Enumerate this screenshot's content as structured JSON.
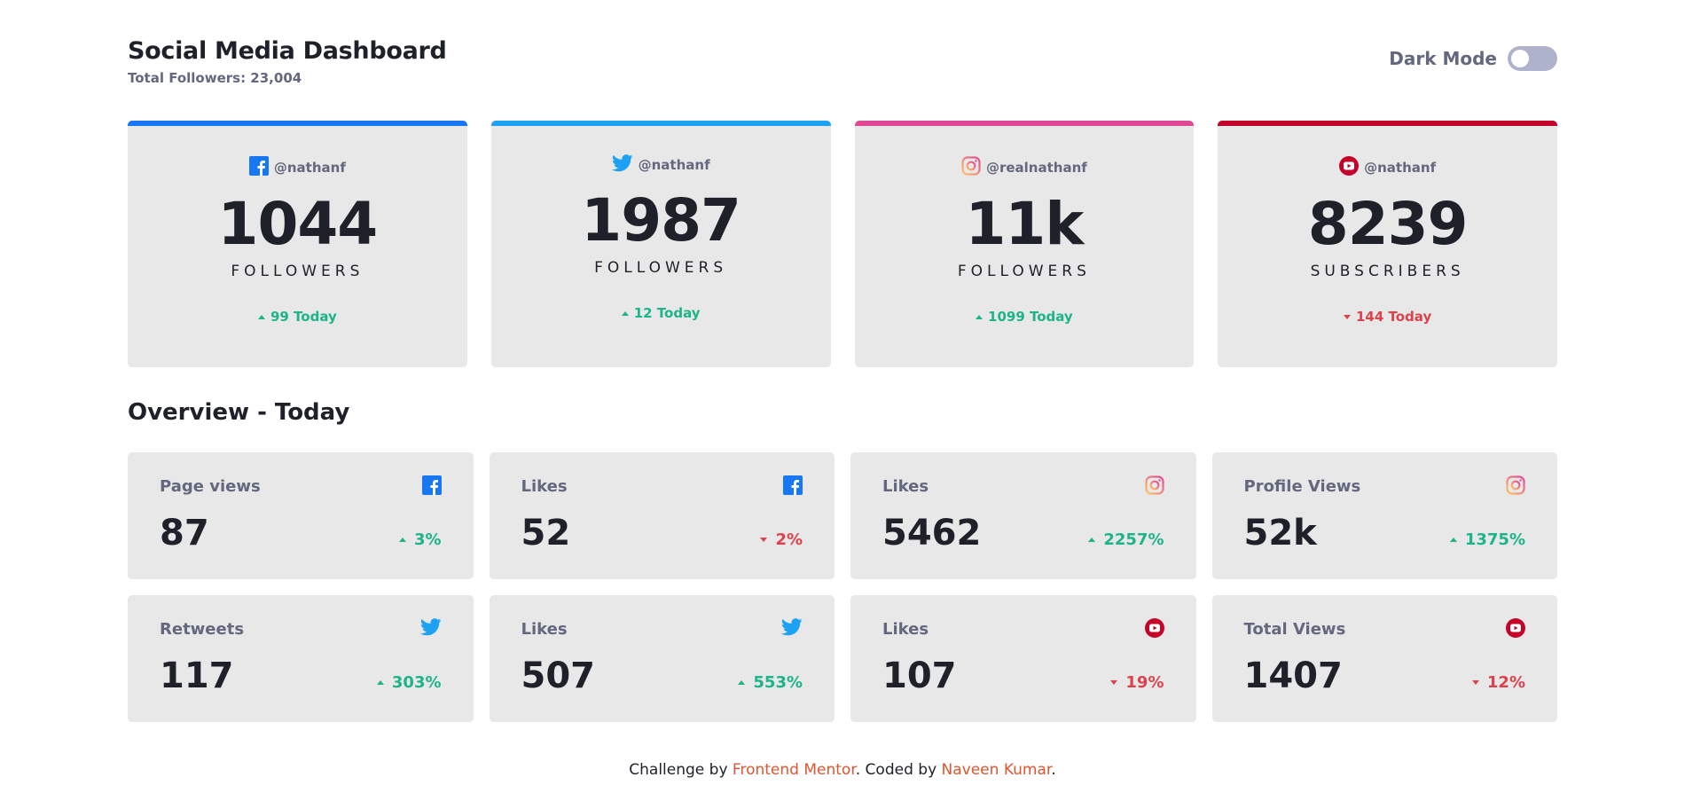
{
  "header": {
    "title": "Social Media Dashboard",
    "subtitle": "Total Followers: 23,004",
    "dark_mode_label": "Dark Mode"
  },
  "colors": {
    "facebook": "#1877f2",
    "twitter": "#1da1f2",
    "instagram_gradient": [
      "#fdc468",
      "#df4996"
    ],
    "youtube": "#c4032a",
    "up": "#1db489",
    "down": "#dc414c",
    "card_bg": "#e8e8e8",
    "footer_link": "#e0552f"
  },
  "cards": [
    {
      "network": "facebook",
      "icon": "facebook-icon",
      "handle": "@nathanf",
      "count": "1044",
      "unit": "FOLLOWERS",
      "today": "99 Today",
      "trend": "up"
    },
    {
      "network": "twitter",
      "icon": "twitter-icon",
      "handle": "@nathanf",
      "count": "1987",
      "unit": "FOLLOWERS",
      "today": "12 Today",
      "trend": "up"
    },
    {
      "network": "instagram",
      "icon": "instagram-icon",
      "handle": "@realnathanf",
      "count": "11k",
      "unit": "FOLLOWERS",
      "today": "1099 Today",
      "trend": "up"
    },
    {
      "network": "youtube",
      "icon": "youtube-icon",
      "handle": "@nathanf",
      "count": "8239",
      "unit": "SUBSCRIBERS",
      "today": "144 Today",
      "trend": "down"
    }
  ],
  "overview": {
    "title": "Overview - Today",
    "tiles": [
      {
        "label": "Page views",
        "icon": "facebook-icon",
        "value": "87",
        "pct": "3%",
        "trend": "up"
      },
      {
        "label": "Likes",
        "icon": "facebook-icon",
        "value": "52",
        "pct": "2%",
        "trend": "down"
      },
      {
        "label": "Likes",
        "icon": "instagram-icon",
        "value": "5462",
        "pct": "2257%",
        "trend": "up"
      },
      {
        "label": "Profile Views",
        "icon": "instagram-icon",
        "value": "52k",
        "pct": "1375%",
        "trend": "up"
      },
      {
        "label": "Retweets",
        "icon": "twitter-icon",
        "value": "117",
        "pct": "303%",
        "trend": "up"
      },
      {
        "label": "Likes",
        "icon": "twitter-icon",
        "value": "507",
        "pct": "553%",
        "trend": "up"
      },
      {
        "label": "Likes",
        "icon": "youtube-icon",
        "value": "107",
        "pct": "19%",
        "trend": "down"
      },
      {
        "label": "Total Views",
        "icon": "youtube-icon",
        "value": "1407",
        "pct": "12%",
        "trend": "down"
      }
    ]
  },
  "footer": {
    "prefix": "Challenge by ",
    "link1": "Frontend Mentor",
    "middle": ". Coded by ",
    "link2": "Naveen Kumar",
    "suffix": "."
  }
}
